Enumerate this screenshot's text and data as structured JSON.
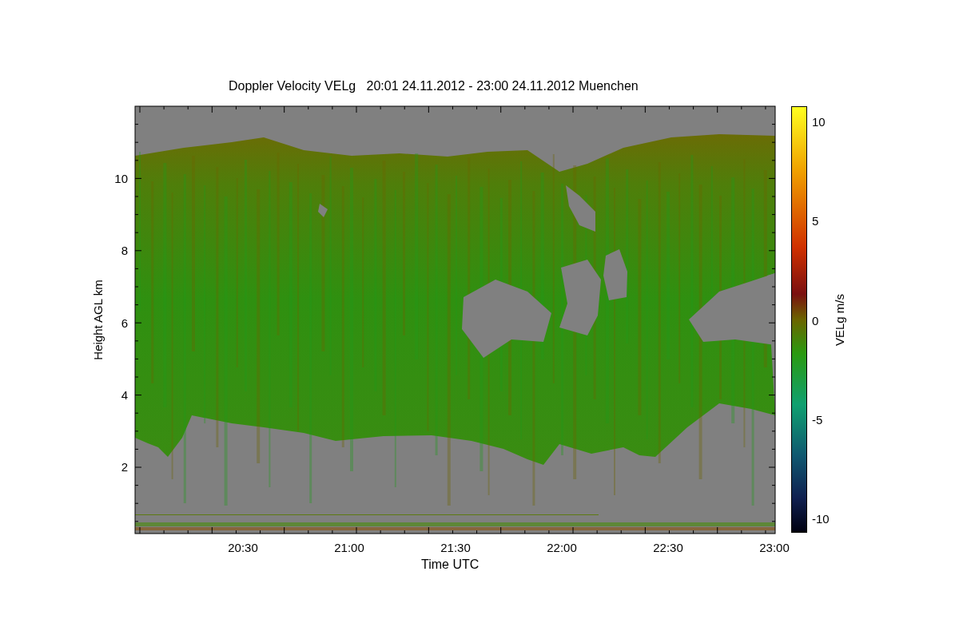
{
  "title": "Doppler Velocity VELg   20:01 24.11.2012 - 23:00 24.11.2012 Muenchen",
  "plot": {
    "ylabel": "Height AGL km",
    "xlabel": "Time UTC",
    "yticks": [
      "10",
      "8",
      "6",
      "4",
      "2"
    ],
    "xticks": [
      "20:30",
      "21:00",
      "21:30",
      "22:00",
      "22:30",
      "23:00"
    ]
  },
  "colorbar": {
    "label": "VELg m/s",
    "ticks": [
      "10",
      "5",
      "0",
      "-5",
      "-10"
    ]
  }
}
